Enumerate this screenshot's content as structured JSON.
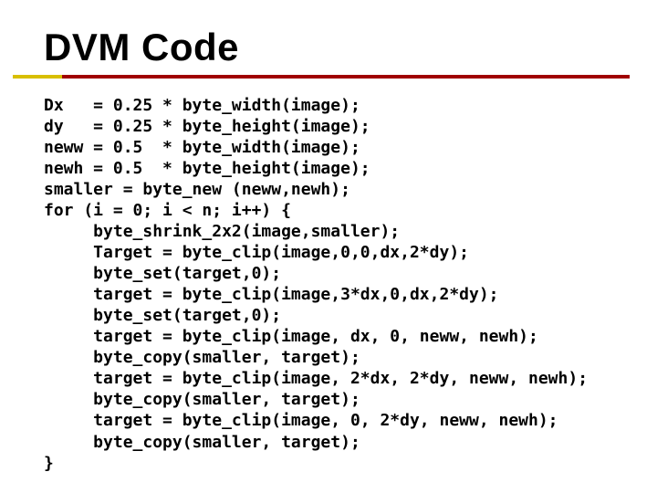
{
  "title": "DVM Code",
  "code_lines": [
    "Dx   = 0.25 * byte_width(image);",
    "dy   = 0.25 * byte_height(image);",
    "neww = 0.5  * byte_width(image);",
    "newh = 0.5  * byte_height(image);",
    "smaller = byte_new (neww,newh);",
    "for (i = 0; i < n; i++) {",
    "     byte_shrink_2x2(image,smaller);",
    "     Target = byte_clip(image,0,0,dx,2*dy);",
    "     byte_set(target,0);",
    "     target = byte_clip(image,3*dx,0,dx,2*dy);",
    "     byte_set(target,0);",
    "     target = byte_clip(image, dx, 0, neww, newh);",
    "     byte_copy(smaller, target);",
    "     target = byte_clip(image, 2*dx, 2*dy, neww, newh);",
    "     byte_copy(smaller, target);",
    "     target = byte_clip(image, 0, 2*dy, neww, newh);",
    "     byte_copy(smaller, target);",
    "}"
  ]
}
